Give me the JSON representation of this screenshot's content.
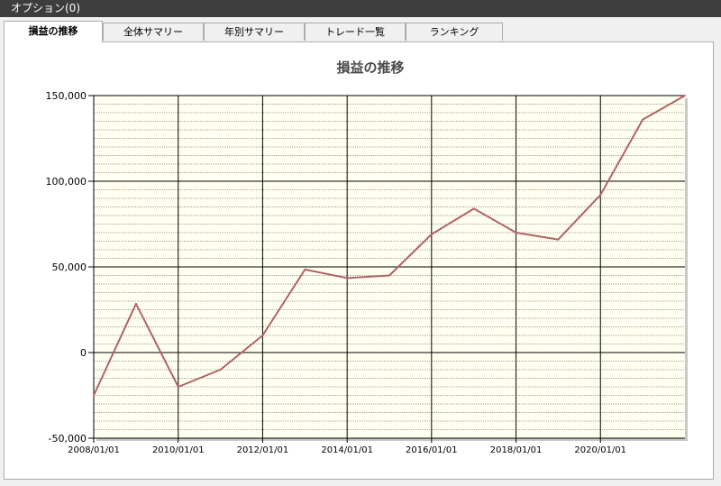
{
  "window": {
    "menu_label": "オプション(0)"
  },
  "tabs": [
    {
      "label": "損益の推移",
      "active": true
    },
    {
      "label": "全体サマリー",
      "active": false
    },
    {
      "label": "年別サマリー",
      "active": false
    },
    {
      "label": "トレード一覧",
      "active": false
    },
    {
      "label": "ランキング",
      "active": false
    }
  ],
  "chart_data": {
    "type": "line",
    "title": "損益の推移",
    "xlabel": "",
    "ylabel": "",
    "x_range": [
      "2008/01/01",
      "2022/01/01"
    ],
    "ylim": [
      -50000,
      150000
    ],
    "y_ticks": [
      {
        "value": -50000,
        "label": "-50,000"
      },
      {
        "value": 0,
        "label": "0"
      },
      {
        "value": 50000,
        "label": "50,000"
      },
      {
        "value": 100000,
        "label": "100,000"
      },
      {
        "value": 150000,
        "label": "150,000"
      }
    ],
    "x_ticks": [
      {
        "date": "2008/01/01",
        "label": "2008/01/01"
      },
      {
        "date": "2010/01/01",
        "label": "2010/01/01"
      },
      {
        "date": "2012/01/01",
        "label": "2012/01/01"
      },
      {
        "date": "2014/01/01",
        "label": "2014/01/01"
      },
      {
        "date": "2016/01/01",
        "label": "2016/01/01"
      },
      {
        "date": "2018/01/01",
        "label": "2018/01/01"
      },
      {
        "date": "2020/01/01",
        "label": "2020/01/01"
      }
    ],
    "grid": true,
    "minor_grid": true,
    "series": [
      {
        "color": "#b06464",
        "points": [
          {
            "x": "2008/01/01",
            "y": -25000
          },
          {
            "x": "2009/01/01",
            "y": 28500
          },
          {
            "x": "2010/01/01",
            "y": -20000
          },
          {
            "x": "2011/01/01",
            "y": -10000
          },
          {
            "x": "2012/01/01",
            "y": 10000
          },
          {
            "x": "2013/01/01",
            "y": 48500
          },
          {
            "x": "2014/01/01",
            "y": 43500
          },
          {
            "x": "2015/01/01",
            "y": 45000
          },
          {
            "x": "2016/01/01",
            "y": 69000
          },
          {
            "x": "2017/01/01",
            "y": 84000
          },
          {
            "x": "2018/01/01",
            "y": 70000
          },
          {
            "x": "2019/01/01",
            "y": 66000
          },
          {
            "x": "2020/01/01",
            "y": 92000
          },
          {
            "x": "2021/01/01",
            "y": 136000
          },
          {
            "x": "2022/01/01",
            "y": 150000
          }
        ]
      }
    ],
    "colors": {
      "plot_bg": "#fffff0",
      "grid": "#000000",
      "minor_grid": "#a0a0a0",
      "axis": "#000000"
    }
  }
}
